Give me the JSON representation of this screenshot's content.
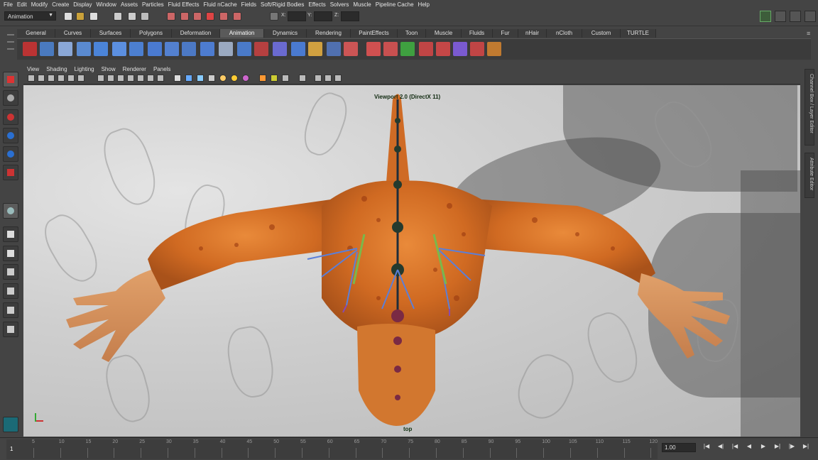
{
  "menu": [
    "File",
    "Edit",
    "Modify",
    "Create",
    "Display",
    "Window",
    "Assets",
    "Particles",
    "Fluid Effects",
    "Fluid nCache",
    "Fields",
    "Soft/Rigid Bodies",
    "Effects",
    "Solvers",
    "Muscle",
    "Pipeline Cache",
    "Help"
  ],
  "status": {
    "mode": "Animation",
    "coord_x_label": "X:",
    "coord_y_label": "Y:",
    "coord_z_label": "Z:"
  },
  "shelf_tabs": [
    "General",
    "Curves",
    "Surfaces",
    "Polygons",
    "Deformation",
    "Animation",
    "Dynamics",
    "Rendering",
    "PaintEffects",
    "Toon",
    "Muscle",
    "Fluids",
    "Fur",
    "nHair",
    "nCloth",
    "Custom",
    "TURTLE"
  ],
  "active_shelf_tab": "Animation",
  "panel_menu": [
    "View",
    "Shading",
    "Lighting",
    "Show",
    "Renderer",
    "Panels"
  ],
  "viewport": {
    "renderer_label": "Viewport 2.0 (DirectX 11)",
    "camera_label": "top"
  },
  "side_tabs": [
    "Channel Box / Layer Editor",
    "Attribute Editor"
  ],
  "timeline": {
    "ticks": [
      "5",
      "10",
      "15",
      "20",
      "25",
      "30",
      "35",
      "40",
      "45",
      "50",
      "55",
      "60",
      "65",
      "70",
      "75",
      "80",
      "85",
      "90",
      "95",
      "100",
      "105",
      "110",
      "115",
      "120"
    ],
    "current_frame": "1",
    "frame_field": "1.00"
  },
  "icons": {
    "dropdown": "chevron-down-icon"
  }
}
